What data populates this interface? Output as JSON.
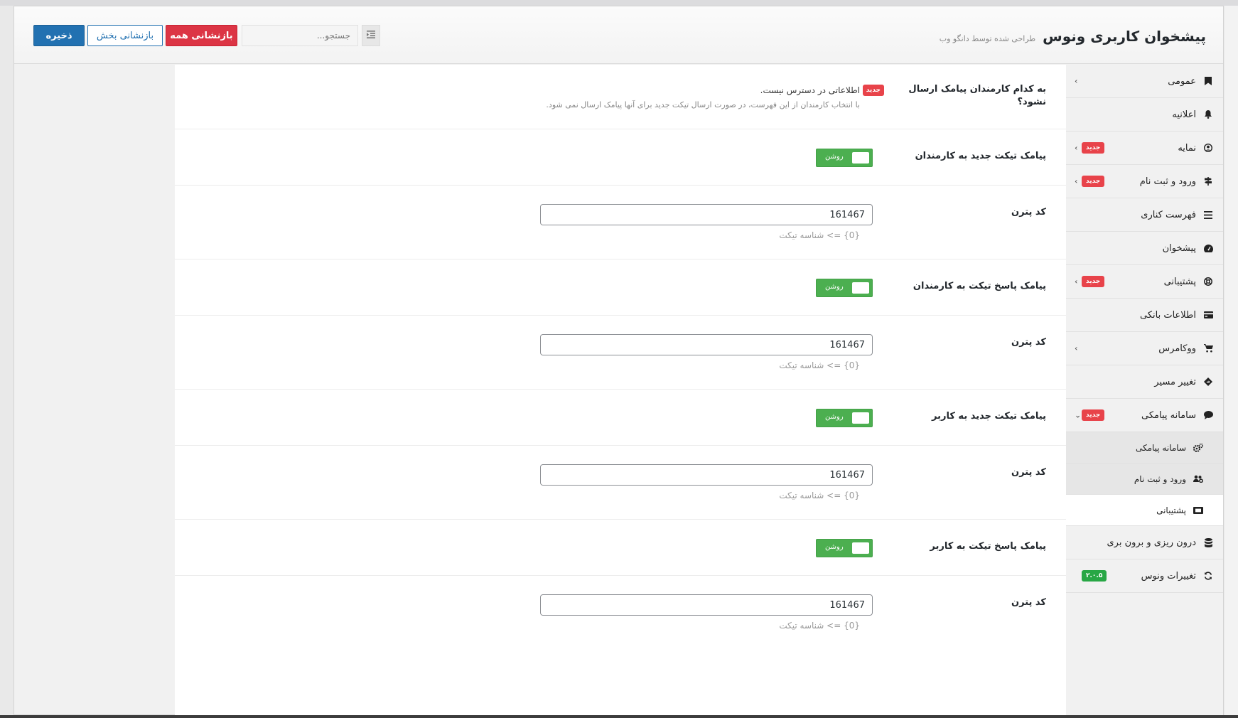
{
  "header": {
    "title": "پیشخوان کاربری ونوس",
    "subtitle": "طراحی شده توسط دانگو وب",
    "save_label": "ذخیره",
    "reset_section_label": "بازنشانی بخش",
    "reset_all_label": "بازنشانی همه",
    "search_placeholder": "جستجو...",
    "expand_icon": "list-indent-icon"
  },
  "sidebar": {
    "items": [
      {
        "label": "عمومی",
        "icon": "bookmark-icon",
        "chevron": "›"
      },
      {
        "label": "اعلانیه",
        "icon": "bell-icon"
      },
      {
        "label": "نمایه",
        "icon": "user-circle-icon",
        "badge": "جدید",
        "chevron": "›"
      },
      {
        "label": "ورود و ثبت نام",
        "icon": "signpost-icon",
        "badge": "جدید",
        "chevron": "›"
      },
      {
        "label": "فهرست کناری",
        "icon": "list-icon"
      },
      {
        "label": "پیشخوان",
        "icon": "dashboard-icon"
      },
      {
        "label": "پشتیبانی",
        "icon": "life-ring-icon",
        "badge": "جدید",
        "chevron": "›"
      },
      {
        "label": "اطلاعات بانکی",
        "icon": "credit-card-icon"
      },
      {
        "label": "ووکامرس",
        "icon": "cart-icon",
        "chevron": "›"
      },
      {
        "label": "تغییر مسیر",
        "icon": "directions-icon"
      },
      {
        "label": "سامانه پیامکی",
        "icon": "comment-icon",
        "badge": "جدید",
        "chevron": "⌄"
      }
    ],
    "subitems": [
      {
        "label": "سامانه پیامکی",
        "icon": "cogs-icon"
      },
      {
        "label": "ورود و ثبت نام",
        "icon": "users-cog-icon"
      },
      {
        "label": "پشتیبانی",
        "icon": "ticket-icon"
      }
    ],
    "bottom_items": [
      {
        "label": "درون ریزی و برون بری",
        "icon": "database-icon"
      },
      {
        "label": "تغییرات ونوس",
        "icon": "refresh-icon",
        "version": "۲.۰.۵"
      }
    ]
  },
  "fields": {
    "exclude_staff": {
      "label": "به کدام کارمندان پیامک ارسال نشود؟",
      "badge": "جدید",
      "info": "اطلاعاتی در دسترس نیست.",
      "help": "با انتخاب کارمندان از این فهرست، در صورت ارسال تیکت جدید برای آنها پیامک ارسال نمی شود."
    },
    "toggle_on_label": "روشن",
    "pattern_label": "کد پترن",
    "pattern_help": "{0} => شناسه تیکت",
    "sections": [
      {
        "toggle_label": "پیامک تیکت جدید به کارمندان",
        "pattern_value": "161467"
      },
      {
        "toggle_label": "پیامک پاسخ تیکت به کارمندان",
        "pattern_value": "161467"
      },
      {
        "toggle_label": "پیامک تیکت جدید به کاربر",
        "pattern_value": "161467"
      },
      {
        "toggle_label": "پیامک پاسخ تیکت به کاربر",
        "pattern_value": "161467"
      }
    ]
  }
}
